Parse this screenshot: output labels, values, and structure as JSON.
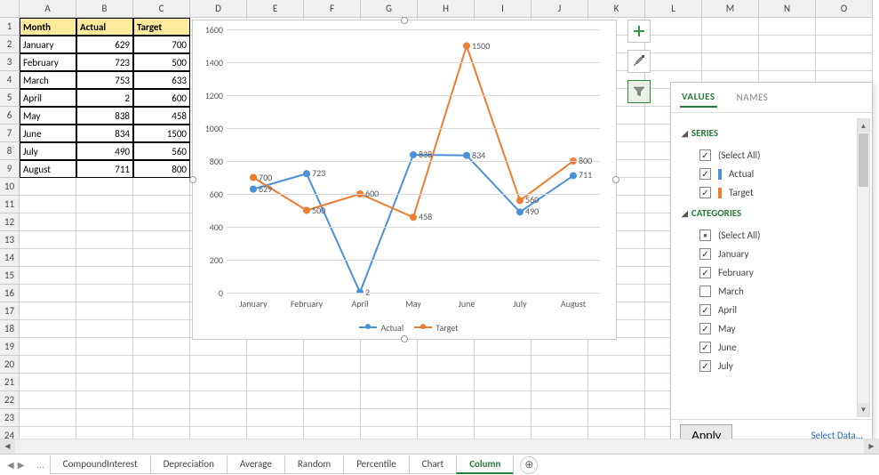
{
  "columns": [
    "A",
    "B",
    "C",
    "D",
    "E",
    "F",
    "G",
    "H",
    "I",
    "J",
    "K",
    "L",
    "M",
    "N",
    "O"
  ],
  "rows": 24,
  "table": {
    "headers": [
      "Month",
      "Actual",
      "Target"
    ],
    "data": [
      [
        "January",
        629,
        700
      ],
      [
        "February",
        723,
        500
      ],
      [
        "March",
        753,
        633
      ],
      [
        "April",
        2,
        600
      ],
      [
        "May",
        838,
        458
      ],
      [
        "June",
        834,
        1500
      ],
      [
        "July",
        490,
        560
      ],
      [
        "August",
        711,
        800
      ]
    ]
  },
  "chart_data": {
    "type": "line",
    "categories": [
      "January",
      "February",
      "April",
      "May",
      "June",
      "July",
      "August"
    ],
    "series": [
      {
        "name": "Actual",
        "values": [
          629,
          723,
          2,
          838,
          834,
          490,
          711
        ],
        "color": "#4a90d9"
      },
      {
        "name": "Target",
        "values": [
          700,
          500,
          600,
          458,
          1500,
          560,
          800
        ],
        "color": "#ed7d31"
      }
    ],
    "ylim": [
      0,
      1600
    ],
    "ytick_step": 200,
    "xlabel": "",
    "ylabel": "",
    "title": "",
    "data_labels": true
  },
  "side_buttons": {
    "add": "plus-icon",
    "brush": "paintbrush-icon",
    "filter": "funnel-icon"
  },
  "filter_panel": {
    "tabs": [
      "VALUES",
      "NAMES"
    ],
    "active_tab": "VALUES",
    "series_header": "SERIES",
    "series_items": [
      {
        "label": "(Select All)",
        "checked": true,
        "swatch": null
      },
      {
        "label": "Actual",
        "checked": true,
        "swatch": "#4a90d9"
      },
      {
        "label": "Target",
        "checked": true,
        "swatch": "#ed7d31"
      }
    ],
    "categories_header": "CATEGORIES",
    "category_items": [
      {
        "label": "(Select All)",
        "checked": "mixed"
      },
      {
        "label": "January",
        "checked": true
      },
      {
        "label": "February",
        "checked": true
      },
      {
        "label": "March",
        "checked": false
      },
      {
        "label": "April",
        "checked": true
      },
      {
        "label": "May",
        "checked": true
      },
      {
        "label": "June",
        "checked": true
      },
      {
        "label": "July",
        "checked": true
      }
    ],
    "apply": "Apply",
    "select_data": "Select Data..."
  },
  "sheet_tabs": {
    "tabs": [
      "CompoundInterest",
      "Depreciation",
      "Average",
      "Random",
      "Percentile",
      "Chart",
      "Column"
    ],
    "active": "Column"
  }
}
